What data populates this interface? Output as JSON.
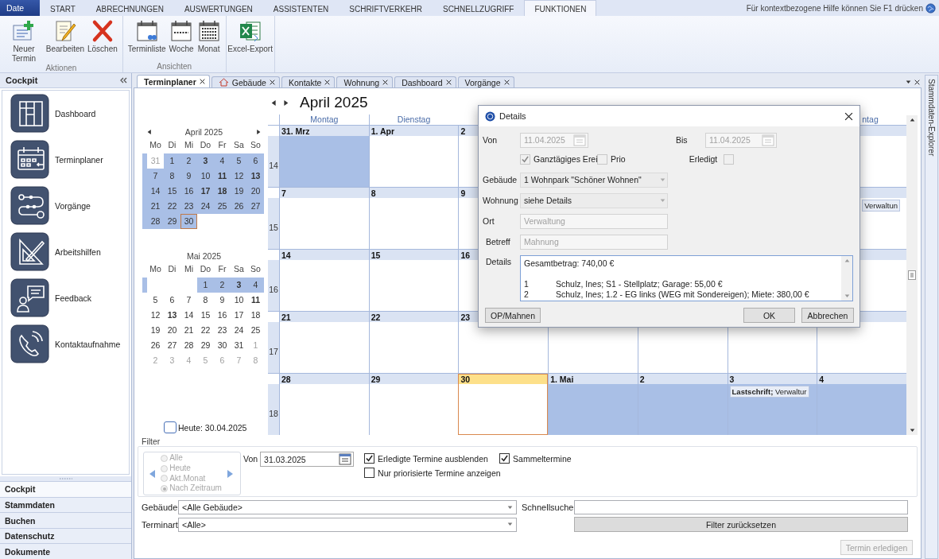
{
  "ribbon": {
    "app_tab": "Date",
    "tabs": [
      {
        "label": "START",
        "selected": false
      },
      {
        "label": "ABRECHNUNGEN",
        "selected": false
      },
      {
        "label": "AUSWERTUNGEN",
        "selected": false
      },
      {
        "label": "ASSISTENTEN",
        "selected": false
      },
      {
        "label": "SCHRIFTVERKEHR",
        "selected": false
      },
      {
        "label": "SCHNELLZUGRIFF",
        "selected": false
      },
      {
        "label": "FUNKTIONEN",
        "selected": true
      }
    ],
    "help": "Für kontextbezogene Hilfe können Sie F1 drücken",
    "groups": [
      {
        "label": "Aktionen",
        "buttons": [
          {
            "label": "Neuer Termin",
            "kind": "new"
          },
          {
            "label": "Bearbeiten",
            "kind": "edit"
          },
          {
            "label": "Löschen",
            "kind": "delete"
          }
        ]
      },
      {
        "label": "Ansichten",
        "buttons": [
          {
            "label": "Terminliste",
            "kind": "list"
          },
          {
            "label": "Woche",
            "kind": "week"
          },
          {
            "label": "Monat",
            "kind": "month"
          }
        ]
      },
      {
        "buttons": [
          {
            "label": "Excel-Export",
            "kind": "excel"
          }
        ]
      }
    ]
  },
  "cockpit": {
    "title": "Cockpit",
    "items": [
      {
        "label": "Dashboard",
        "kind": "dashboard"
      },
      {
        "label": "Terminplaner",
        "kind": "planner"
      },
      {
        "label": "Vorgänge",
        "kind": "process"
      },
      {
        "label": "Arbeitshilfen",
        "kind": "tools"
      },
      {
        "label": "Feedback",
        "kind": "feedback"
      },
      {
        "label": "Kontaktaufnahme",
        "kind": "contact"
      }
    ],
    "sections": [
      {
        "label": "Cockpit",
        "selected": true
      },
      {
        "label": "Stammdaten",
        "selected": false
      },
      {
        "label": "Buchen",
        "selected": false
      },
      {
        "label": "Datenschutz",
        "selected": false
      },
      {
        "label": "Dokumente",
        "selected": false
      }
    ]
  },
  "doc_tabs": [
    {
      "label": "Terminplaner",
      "selected": true,
      "kind": "plain"
    },
    {
      "label": "Gebäude",
      "selected": false,
      "kind": "building"
    },
    {
      "label": "Kontakte",
      "selected": false,
      "kind": "plain"
    },
    {
      "label": "Wohnung",
      "selected": false,
      "kind": "plain"
    },
    {
      "label": "Dashboard",
      "selected": false,
      "kind": "plain"
    },
    {
      "label": "Vorgänge",
      "selected": false,
      "kind": "plain"
    }
  ],
  "explorer": "Stammdaten-Explorer",
  "planner": {
    "title": "April 2025",
    "mini_calendars": [
      {
        "title": "April 2025",
        "weekdays": [
          "Mo",
          "Di",
          "Mi",
          "Do",
          "Fr",
          "Sa",
          "So"
        ],
        "weeks": [
          [
            {
              "day": "31",
              "other": true,
              "bold": false,
              "shaded": false,
              "today": false
            },
            {
              "day": "1",
              "other": false,
              "bold": false,
              "shaded": true,
              "today": false
            },
            {
              "day": "2",
              "other": false,
              "bold": false,
              "shaded": true,
              "today": false
            },
            {
              "day": "3",
              "other": false,
              "bold": true,
              "shaded": true,
              "today": false
            },
            {
              "day": "4",
              "other": false,
              "bold": false,
              "shaded": true,
              "today": false
            },
            {
              "day": "5",
              "other": false,
              "bold": false,
              "shaded": true,
              "today": false
            },
            {
              "day": "6",
              "other": false,
              "bold": false,
              "shaded": true,
              "today": false
            }
          ],
          [
            {
              "day": "7",
              "other": false,
              "bold": false,
              "shaded": true,
              "today": false
            },
            {
              "day": "8",
              "other": false,
              "bold": false,
              "shaded": true,
              "today": false
            },
            {
              "day": "9",
              "other": false,
              "bold": false,
              "shaded": true,
              "today": false
            },
            {
              "day": "10",
              "other": false,
              "bold": false,
              "shaded": true,
              "today": false
            },
            {
              "day": "11",
              "other": false,
              "bold": true,
              "shaded": true,
              "today": false
            },
            {
              "day": "12",
              "other": false,
              "bold": false,
              "shaded": true,
              "today": false
            },
            {
              "day": "13",
              "other": false,
              "bold": true,
              "shaded": true,
              "today": false
            }
          ],
          [
            {
              "day": "14",
              "other": false,
              "bold": false,
              "shaded": true,
              "today": false
            },
            {
              "day": "15",
              "other": false,
              "bold": false,
              "shaded": true,
              "today": false
            },
            {
              "day": "16",
              "other": false,
              "bold": false,
              "shaded": true,
              "today": false
            },
            {
              "day": "17",
              "other": false,
              "bold": true,
              "shaded": true,
              "today": false
            },
            {
              "day": "18",
              "other": false,
              "bold": true,
              "shaded": true,
              "today": false
            },
            {
              "day": "19",
              "other": false,
              "bold": false,
              "shaded": true,
              "today": false
            },
            {
              "day": "20",
              "other": false,
              "bold": false,
              "shaded": true,
              "today": false
            }
          ],
          [
            {
              "day": "21",
              "other": false,
              "bold": false,
              "shaded": true,
              "today": false
            },
            {
              "day": "22",
              "other": false,
              "bold": false,
              "shaded": true,
              "today": false
            },
            {
              "day": "23",
              "other": false,
              "bold": false,
              "shaded": true,
              "today": false
            },
            {
              "day": "24",
              "other": false,
              "bold": false,
              "shaded": true,
              "today": false
            },
            {
              "day": "25",
              "other": false,
              "bold": false,
              "shaded": true,
              "today": false
            },
            {
              "day": "26",
              "other": false,
              "bold": false,
              "shaded": true,
              "today": false
            },
            {
              "day": "27",
              "other": false,
              "bold": false,
              "shaded": true,
              "today": false
            }
          ],
          [
            {
              "day": "28",
              "other": false,
              "bold": false,
              "shaded": true,
              "today": false
            },
            {
              "day": "29",
              "other": false,
              "bold": false,
              "shaded": true,
              "today": false
            },
            {
              "day": "30",
              "other": false,
              "bold": false,
              "shaded": true,
              "today": true
            }
          ]
        ]
      },
      {
        "title": "Mai 2025",
        "weekdays": [
          "Mo",
          "Di",
          "Mi",
          "Do",
          "Fr",
          "Sa",
          "So"
        ],
        "weeks": [
          [
            {
              "day": "1",
              "other": false,
              "bold": false,
              "shaded": true,
              "today": false
            },
            {
              "day": "2",
              "other": false,
              "bold": false,
              "shaded": true,
              "today": false
            },
            {
              "day": "3",
              "other": false,
              "bold": true,
              "shaded": true,
              "today": false
            },
            {
              "day": "4",
              "other": false,
              "bold": false,
              "shaded": true,
              "today": false
            }
          ],
          [
            {
              "day": "5",
              "other": false,
              "bold": false,
              "shaded": false,
              "today": false
            },
            {
              "day": "6",
              "other": false,
              "bold": false,
              "shaded": false,
              "today": false
            },
            {
              "day": "7",
              "other": false,
              "bold": false,
              "shaded": false,
              "today": false
            },
            {
              "day": "8",
              "other": false,
              "bold": false,
              "shaded": false,
              "today": false
            },
            {
              "day": "9",
              "other": false,
              "bold": false,
              "shaded": false,
              "today": false
            },
            {
              "day": "10",
              "other": false,
              "bold": false,
              "shaded": false,
              "today": false
            },
            {
              "day": "11",
              "other": false,
              "bold": true,
              "shaded": false,
              "today": false
            }
          ],
          [
            {
              "day": "12",
              "other": false,
              "bold": false,
              "shaded": false,
              "today": false
            },
            {
              "day": "13",
              "other": false,
              "bold": true,
              "shaded": false,
              "today": false
            },
            {
              "day": "14",
              "other": false,
              "bold": false,
              "shaded": false,
              "today": false
            },
            {
              "day": "15",
              "other": false,
              "bold": false,
              "shaded": false,
              "today": false
            },
            {
              "day": "16",
              "other": false,
              "bold": false,
              "shaded": false,
              "today": false
            },
            {
              "day": "17",
              "other": false,
              "bold": false,
              "shaded": false,
              "today": false
            },
            {
              "day": "18",
              "other": false,
              "bold": false,
              "shaded": false,
              "today": false
            }
          ],
          [
            {
              "day": "19",
              "other": false,
              "bold": false,
              "shaded": false,
              "today": false
            },
            {
              "day": "20",
              "other": false,
              "bold": false,
              "shaded": false,
              "today": false
            },
            {
              "day": "21",
              "other": false,
              "bold": false,
              "shaded": false,
              "today": false
            },
            {
              "day": "22",
              "other": false,
              "bold": false,
              "shaded": false,
              "today": false
            },
            {
              "day": "23",
              "other": false,
              "bold": false,
              "shaded": false,
              "today": false
            },
            {
              "day": "24",
              "other": false,
              "bold": false,
              "shaded": false,
              "today": false
            },
            {
              "day": "25",
              "other": false,
              "bold": false,
              "shaded": false,
              "today": false
            }
          ],
          [
            {
              "day": "26",
              "other": false,
              "bold": false,
              "shaded": false,
              "today": false
            },
            {
              "day": "27",
              "other": false,
              "bold": false,
              "shaded": false,
              "today": false
            },
            {
              "day": "28",
              "other": false,
              "bold": false,
              "shaded": false,
              "today": false
            },
            {
              "day": "29",
              "other": false,
              "bold": false,
              "shaded": false,
              "today": false
            },
            {
              "day": "30",
              "other": false,
              "bold": false,
              "shaded": false,
              "today": false
            },
            {
              "day": "31",
              "other": false,
              "bold": false,
              "shaded": false,
              "today": false
            },
            {
              "day": "1",
              "other": true,
              "bold": false,
              "shaded": false,
              "today": false
            }
          ],
          [
            {
              "day": "2",
              "other": true,
              "bold": false,
              "shaded": false,
              "today": false
            },
            {
              "day": "3",
              "other": true,
              "bold": false,
              "shaded": false,
              "today": false
            },
            {
              "day": "4",
              "other": true,
              "bold": false,
              "shaded": false,
              "today": false
            },
            {
              "day": "5",
              "other": true,
              "bold": false,
              "shaded": false,
              "today": false
            },
            {
              "day": "6",
              "other": true,
              "bold": false,
              "shaded": false,
              "today": false
            },
            {
              "day": "7",
              "other": true,
              "bold": false,
              "shaded": false,
              "today": false
            },
            {
              "day": "8",
              "other": true,
              "bold": false,
              "shaded": false,
              "today": false
            }
          ]
        ]
      }
    ],
    "today_box": {
      "label": "Heute: 30.04.2025",
      "checked": false
    },
    "day_headers": [
      "Montag",
      "Dienstag",
      "ntag"
    ],
    "weeks": [
      {
        "number": "14",
        "days": [
          {
            "date": "31. Mrz",
            "shaded": true,
            "today": false
          },
          {
            "date": "1. Apr",
            "shaded": false,
            "today": false
          },
          {
            "date": "2",
            "shaded": false,
            "today": false
          },
          {
            "shaded": false,
            "today": false
          }
        ]
      },
      {
        "number": "15",
        "days": [
          {
            "date": "7",
            "shaded": false,
            "today": false
          },
          {
            "date": "8",
            "shaded": false,
            "today": false
          },
          {
            "date": "9",
            "shaded": false,
            "today": false
          },
          {
            "shaded": false,
            "today": false,
            "events": [
              "Verwaltun"
            ]
          }
        ]
      },
      {
        "number": "16",
        "days": [
          {
            "date": "14",
            "shaded": false,
            "today": false
          },
          {
            "date": "15",
            "shaded": false,
            "today": false
          },
          {
            "date": "16",
            "shaded": false,
            "today": false
          },
          {
            "shaded": false,
            "today": false
          }
        ]
      },
      {
        "number": "17",
        "days": [
          {
            "date": "21",
            "shaded": false,
            "today": false
          },
          {
            "date": "22",
            "shaded": false,
            "today": false
          },
          {
            "date": "23",
            "shaded": false,
            "today": false
          },
          {
            "shaded": false,
            "today": false
          },
          {
            "shaded": false,
            "today": false
          },
          {
            "shaded": false,
            "today": false
          },
          {
            "shaded": false,
            "today": false
          }
        ]
      },
      {
        "number": "18",
        "days": [
          {
            "date": "28",
            "shaded": false,
            "today": false
          },
          {
            "date": "29",
            "shaded": false,
            "today": false
          },
          {
            "date": "30",
            "shaded": false,
            "today": true
          },
          {
            "date": "1. Mai",
            "shaded": true,
            "today": false
          },
          {
            "date": "2",
            "shaded": true,
            "today": false
          },
          {
            "date": "3",
            "shaded": true,
            "today": false,
            "events": [
              "**Lastschrift;** Verwaltur"
            ]
          },
          {
            "date": "4",
            "shaded": true,
            "today": false
          }
        ]
      }
    ]
  },
  "dialog": {
    "title": "Details",
    "from": {
      "label": "Von",
      "value": "11.04.2025"
    },
    "to": {
      "label": "Bis",
      "value": "11.04.2025"
    },
    "all_day": {
      "label": "Ganztägiges Erei",
      "checked": true
    },
    "prio": {
      "label": "Prio",
      "checked": false
    },
    "done": {
      "label": "Erledigt",
      "checked": false
    },
    "building": {
      "label": "Gebäude",
      "value": "1 Wohnpark \"Schöner Wohnen\""
    },
    "flat": {
      "label": "Wohnung",
      "value": "siehe Details"
    },
    "place": {
      "label": "Ort",
      "value": "Verwaltung"
    },
    "subject": {
      "label": "Betreff",
      "value": "Mahnung"
    },
    "details": {
      "label": "Details",
      "lines": [
        {
          "text": "Gesamtbetrag: 740,00 €"
        },
        {
          "number": "1",
          "text": "Schulz, Ines; S1 - Stellplatz;  Garage: 55,00 €"
        },
        {
          "number": "2",
          "text": "Schulz, Ines; 1.2 - EG links (WEG mit Sondereigen);  Miete: 380,00 €"
        }
      ]
    },
    "buttons": {
      "left": "OP/Mahnen",
      "ok": "OK",
      "cancel": "Abbrechen"
    }
  },
  "filter": {
    "title": "Filter",
    "modes": [
      {
        "label": "Alle",
        "selected": false
      },
      {
        "label": "Heute",
        "selected": false
      },
      {
        "label": "Akt.Monat",
        "selected": false
      },
      {
        "label": "Nach Zeitraum",
        "selected": true
      }
    ],
    "from": {
      "label": "Von",
      "value": "31.03.2025"
    },
    "checks": [
      {
        "label": "Erledigte Termine ausblenden",
        "checked": true
      },
      {
        "label": "Sammeltermine",
        "checked": true
      },
      {
        "label": "Nur priorisierte Termine anzeigen",
        "checked": false
      }
    ],
    "building": {
      "label": "Gebäude",
      "value": "<Alle Gebäude>"
    },
    "type": {
      "label": "Terminart",
      "value": "<Alle>"
    },
    "search": {
      "label": "Schnellsuche"
    },
    "reset": "Filter zurücksetzen"
  },
  "footer": {
    "button": "Termin erledigen",
    "disabled": true
  }
}
